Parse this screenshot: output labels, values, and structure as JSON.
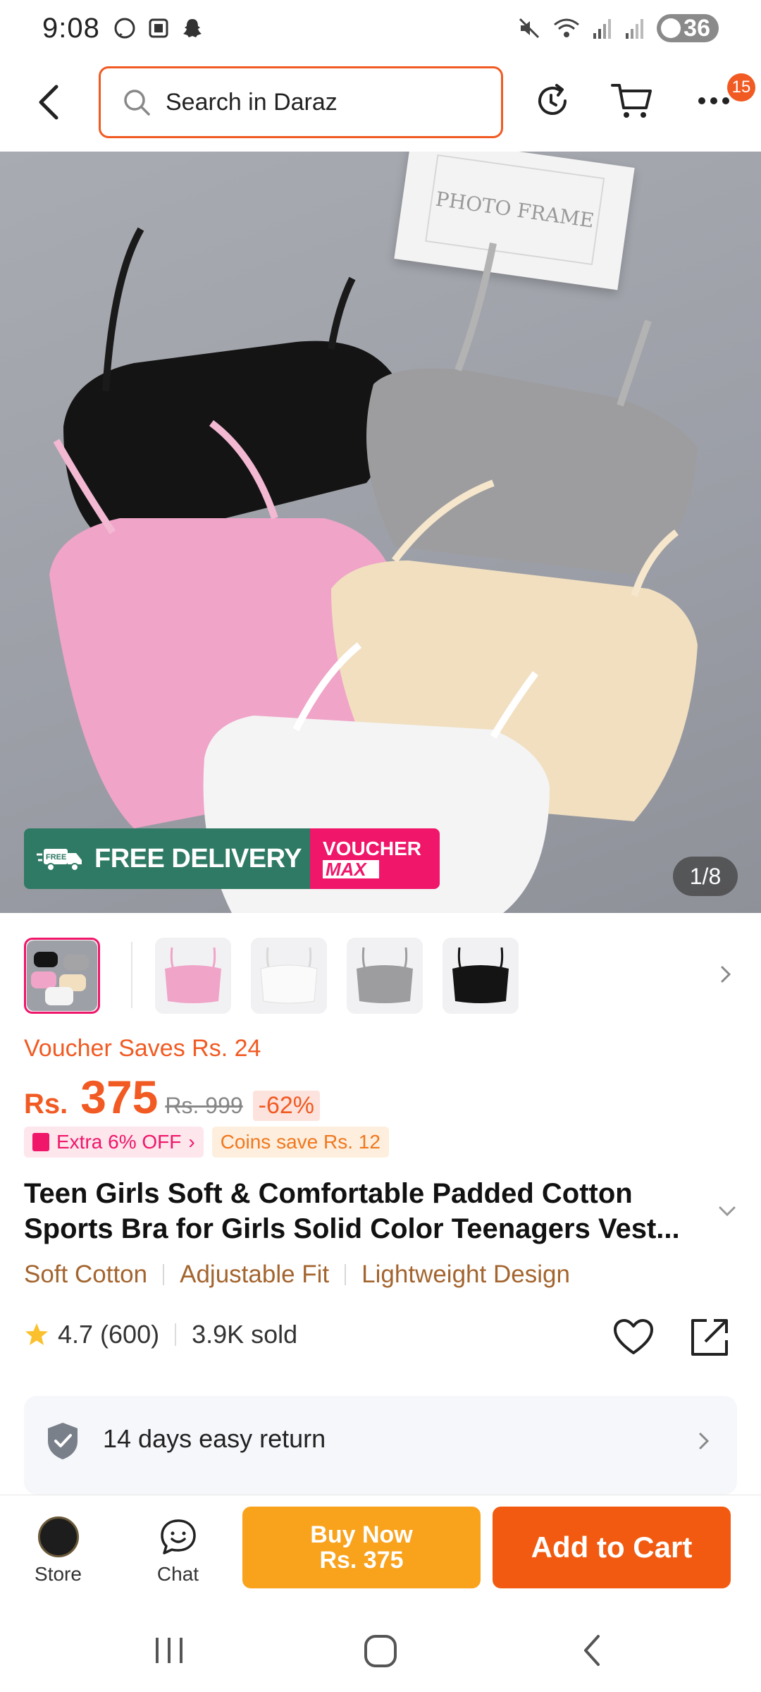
{
  "status_bar": {
    "time": "9:08",
    "battery": "36",
    "left_icons": [
      "whatsapp-icon",
      "screenshot-icon",
      "snapchat-icon"
    ],
    "right_icons": [
      "mute-icon",
      "wifi-icon",
      "signal-icon",
      "signal-icon-2",
      "battery-icon"
    ]
  },
  "header": {
    "search_placeholder": "Search in Daraz",
    "notification_count": "15"
  },
  "hero": {
    "frame_text": "PHOTO FRAME",
    "badge_free": "FREE",
    "free_delivery": "FREE DELIVERY",
    "voucher_line1": "VOUCHER",
    "voucher_line2": "MAX",
    "image_counter": "1/8"
  },
  "thumbnails": [
    {
      "name": "mixed"
    },
    {
      "name": "pink"
    },
    {
      "name": "white"
    },
    {
      "name": "grey"
    },
    {
      "name": "black"
    }
  ],
  "pricing": {
    "voucher_saves": "Voucher Saves Rs. 24",
    "currency": "Rs.",
    "price": "375",
    "original_price": "Rs. 999",
    "discount": "-62%",
    "promo_extra": "Extra 6% OFF",
    "promo_coins": "Coins save Rs. 12"
  },
  "product": {
    "title_line1": "Teen Girls Soft & Comfortable Padded Cotton",
    "title_line2": "Sports Bra for Girls Solid Color Teenagers Vest...",
    "features": [
      "Soft Cotton",
      "Adjustable Fit",
      "Lightweight Design"
    ],
    "rating": "4.7",
    "reviews": "(600)",
    "sold": "3.9K sold"
  },
  "return_policy": {
    "text": "14 days easy return"
  },
  "actions": {
    "store_label": "Store",
    "chat_label": "Chat",
    "buy_now_line1": "Buy Now",
    "buy_now_line2": "Rs. 375",
    "add_to_cart": "Add to Cart"
  },
  "colors": {
    "brand_orange": "#f15a22",
    "buy_now": "#f9a21c",
    "add_to_cart": "#f15a10",
    "voucher_pink": "#f0166a",
    "delivery_green": "#2f7a64"
  }
}
